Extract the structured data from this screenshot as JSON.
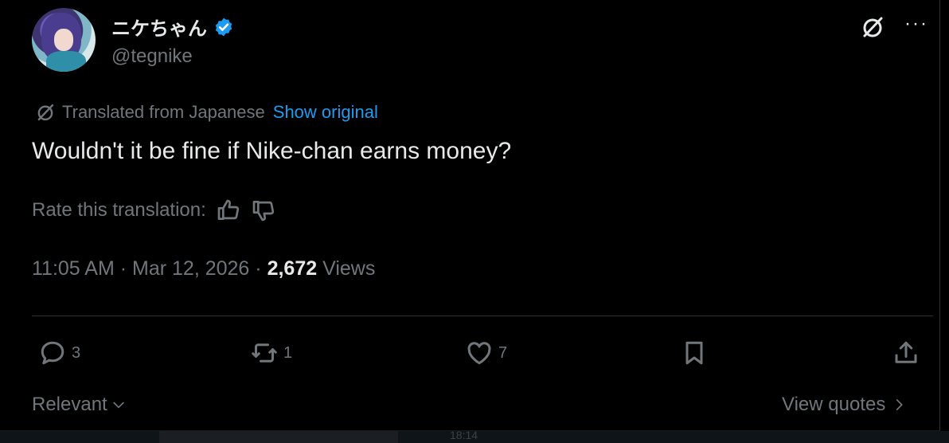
{
  "user": {
    "display_name": "ニケちゃん",
    "handle": "@tegnike"
  },
  "translation": {
    "notice": "Translated from Japanese",
    "show_original": "Show original"
  },
  "tweet": {
    "text": "Wouldn't it be fine if Nike-chan earns money?"
  },
  "rate": {
    "label": "Rate this translation:"
  },
  "meta": {
    "time": "11:05 AM",
    "separator": "·",
    "date": "Mar 12, 2026",
    "views_count": "2,672",
    "views_label": "Views"
  },
  "actions": {
    "replies": "3",
    "reposts": "1",
    "likes": "7"
  },
  "footer": {
    "sort_label": "Relevant",
    "view_quotes": "View quotes"
  },
  "overlay": {
    "clock": "18:14"
  },
  "colors": {
    "accent": "#1d9bf0",
    "text": "#e7e9ea",
    "muted": "#71767b",
    "background": "#000000"
  },
  "icons": [
    "verified-badge-icon",
    "grok-icon",
    "more-icon",
    "thumbs-up-icon",
    "thumbs-down-icon",
    "reply-icon",
    "repost-icon",
    "like-icon",
    "bookmark-icon",
    "share-icon",
    "chevron-down-icon",
    "chevron-right-icon"
  ]
}
